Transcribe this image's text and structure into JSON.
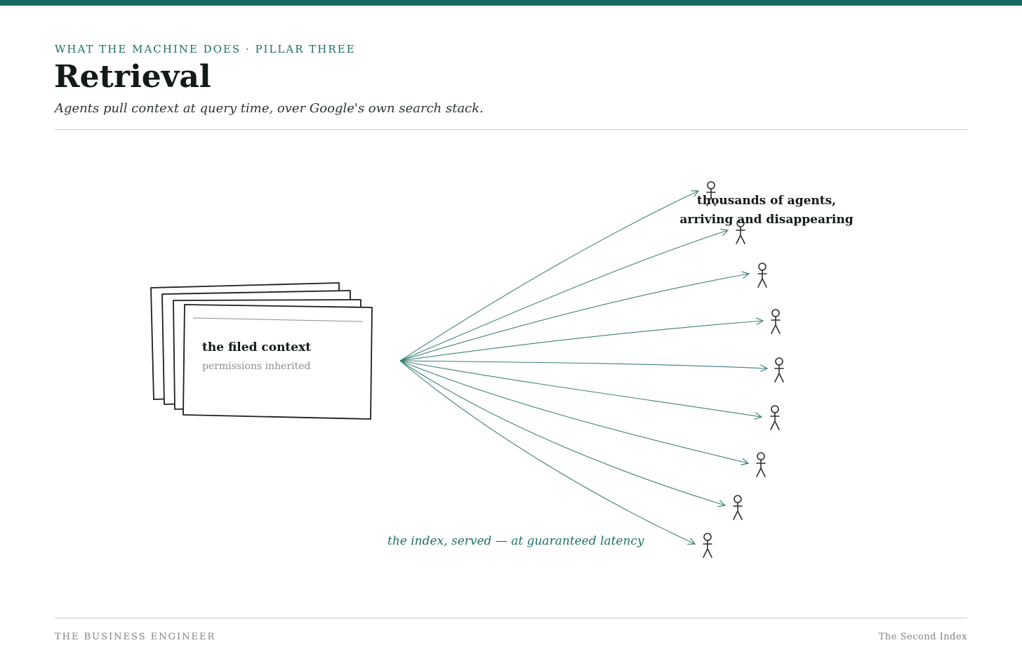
{
  "header": {
    "eyebrow": "WHAT THE MACHINE DOES · PILLAR THREE",
    "title": "Retrieval",
    "subtitle": "Agents pull context at query time, over Google's own search stack."
  },
  "diagram": {
    "stack": {
      "title": "the filed context",
      "subtitle": "permissions inherited",
      "sheet_count": 4
    },
    "agents": {
      "label_line1": "thousands of agents,",
      "label_line2": "arriving and disappearing",
      "count": 9
    },
    "index_label": "the index, served — at guaranteed latency"
  },
  "footer": {
    "left": "THE BUSINESS ENGINEER",
    "right": "The Second Index"
  },
  "colors": {
    "accent": "#176b63",
    "arrow": "#3f8079",
    "ink": "#141a19",
    "muted": "#7d8482"
  }
}
